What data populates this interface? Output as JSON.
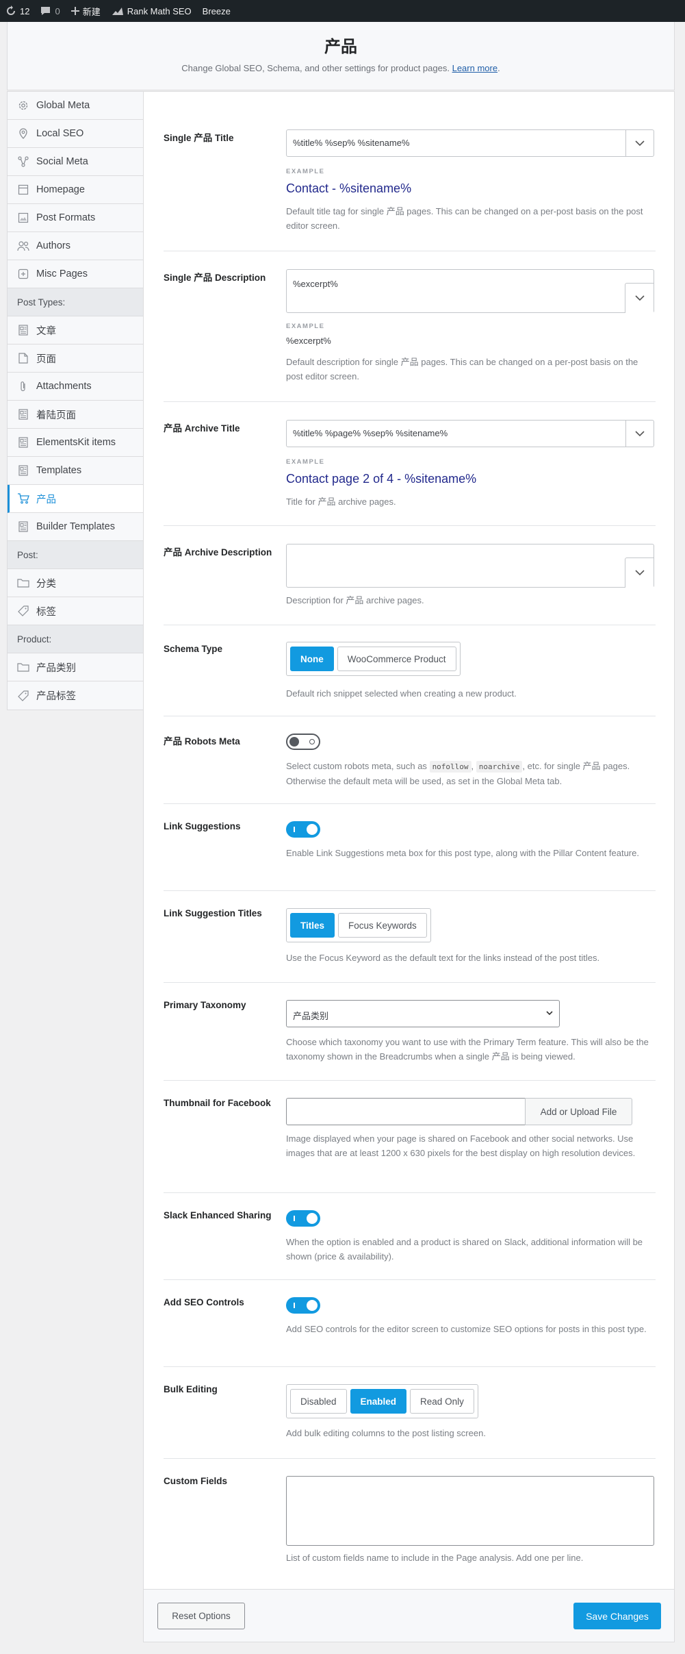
{
  "adminbar": {
    "updates_count": "12",
    "comments_count": "0",
    "new_label": "新建",
    "rankmath_label": "Rank Math SEO",
    "breeze_label": "Breeze"
  },
  "header": {
    "title": "产品",
    "description": "Change Global SEO, Schema, and other settings for product pages.",
    "learn_more": "Learn more",
    "period": "."
  },
  "sidebar": {
    "items": [
      {
        "label": "Global Meta",
        "icon": "gear-icon"
      },
      {
        "label": "Local SEO",
        "icon": "location-pin-icon"
      },
      {
        "label": "Social Meta",
        "icon": "share-icon"
      },
      {
        "label": "Homepage",
        "icon": "home-icon"
      },
      {
        "label": "Post Formats",
        "icon": "image-icon"
      },
      {
        "label": "Authors",
        "icon": "users-icon"
      },
      {
        "label": "Misc Pages",
        "icon": "misc-pages-icon"
      }
    ],
    "section_post_types": "Post Types:",
    "post_types": [
      {
        "label": "文章",
        "icon": "post-icon"
      },
      {
        "label": "页面",
        "icon": "page-icon"
      },
      {
        "label": "Attachments",
        "icon": "paperclip-icon"
      },
      {
        "label": "着陆页面",
        "icon": "post-icon"
      },
      {
        "label": "ElementsKit items",
        "icon": "post-icon"
      },
      {
        "label": "Templates",
        "icon": "post-icon"
      },
      {
        "label": "产品",
        "icon": "cart-icon",
        "active": true
      },
      {
        "label": "Builder Templates",
        "icon": "post-icon"
      }
    ],
    "section_post": "Post:",
    "post": [
      {
        "label": "分类",
        "icon": "folder-icon"
      },
      {
        "label": "标签",
        "icon": "tag-icon"
      }
    ],
    "section_product": "Product:",
    "product": [
      {
        "label": "产品类别",
        "icon": "folder-icon"
      },
      {
        "label": "产品标签",
        "icon": "tag-icon"
      }
    ]
  },
  "settings": {
    "single_title": {
      "label": "Single 产品 Title",
      "value": "%title% %sep% %sitename%",
      "example_label": "EXAMPLE",
      "example": "Contact - %sitename%",
      "desc": "Default title tag for single 产品 pages. This can be changed on a per-post basis on the post editor screen."
    },
    "single_desc": {
      "label": "Single 产品 Description",
      "value": "%excerpt%",
      "example_label": "EXAMPLE",
      "example": "%excerpt%",
      "desc": "Default description for single 产品 pages. This can be changed on a per-post basis on the post editor screen."
    },
    "archive_title": {
      "label": "产品 Archive Title",
      "value": "%title% %page% %sep% %sitename%",
      "example_label": "EXAMPLE",
      "example": "Contact page 2 of 4 - %sitename%",
      "desc": "Title for 产品 archive pages."
    },
    "archive_desc": {
      "label": "产品 Archive Description",
      "value": "",
      "desc": "Description for 产品 archive pages."
    },
    "schema_type": {
      "label": "Schema Type",
      "options": [
        "None",
        "WooCommerce Product"
      ],
      "selected": "None",
      "desc": "Default rich snippet selected when creating a new product."
    },
    "robots_meta": {
      "label": "产品 Robots Meta",
      "state": "off",
      "desc_before": "Select custom robots meta, such as",
      "code1": "nofollow",
      "sep": ",",
      "code2": "noarchive",
      "desc_after": ", etc. for single 产品 pages. Otherwise the default meta will be used, as set in the Global Meta tab."
    },
    "link_suggestions": {
      "label": "Link Suggestions",
      "state": "on",
      "desc": "Enable Link Suggestions meta box for this post type, along with the Pillar Content feature."
    },
    "link_suggestion_titles": {
      "label": "Link Suggestion Titles",
      "options": [
        "Titles",
        "Focus Keywords"
      ],
      "selected": "Titles",
      "desc": "Use the Focus Keyword as the default text for the links instead of the post titles."
    },
    "primary_taxonomy": {
      "label": "Primary Taxonomy",
      "value": "产品类别",
      "desc": "Choose which taxonomy you want to use with the Primary Term feature. This will also be the taxonomy shown in the Breadcrumbs when a single 产品 is being viewed."
    },
    "thumbnail_facebook": {
      "label": "Thumbnail for Facebook",
      "value": "",
      "button": "Add or Upload File",
      "desc": "Image displayed when your page is shared on Facebook and other social networks. Use images that are at least 1200 x 630 pixels for the best display on high resolution devices."
    },
    "slack_sharing": {
      "label": "Slack Enhanced Sharing",
      "state": "on",
      "desc": "When the option is enabled and a product is shared on Slack, additional information will be shown (price & availability)."
    },
    "seo_controls": {
      "label": "Add SEO Controls",
      "state": "on",
      "desc": "Add SEO controls for the editor screen to customize SEO options for posts in this post type."
    },
    "bulk_editing": {
      "label": "Bulk Editing",
      "options": [
        "Disabled",
        "Enabled",
        "Read Only"
      ],
      "selected": "Enabled",
      "desc": "Add bulk editing columns to the post listing screen."
    },
    "custom_fields": {
      "label": "Custom Fields",
      "value": "",
      "desc": "List of custom fields name to include in the Page analysis. Add one per line."
    }
  },
  "footer": {
    "reset_label": "Reset Options",
    "save_label": "Save Changes"
  },
  "colors": {
    "accent": "#129ae0",
    "example_text": "#22298c",
    "adminbar_bg": "#1d2327"
  }
}
